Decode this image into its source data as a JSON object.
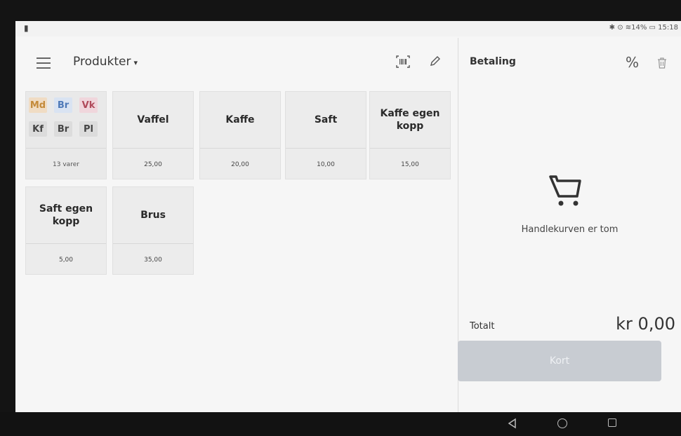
{
  "statusbar": {
    "left_glyph": "▮",
    "right_text": "✱ ⊙ ≋14% ▭ 15:18"
  },
  "header": {
    "title": "Produkter",
    "caret": "▾",
    "icons": [
      "menu-icon",
      "barcode-icon",
      "pencil-icon"
    ]
  },
  "payment": {
    "title": "Betaling",
    "discount": "%",
    "icons": [
      "trash-icon",
      "shopping-cart-icon"
    ],
    "cart_empty": "Handlekurven er tom",
    "total_label": "Totalt",
    "total_value": "kr 0,00",
    "button_label": "Kort"
  },
  "category_tile": {
    "chips": [
      {
        "label": "Md",
        "color": "#c48a3a",
        "bg": "#f0dcc4"
      },
      {
        "label": "Br",
        "color": "#4e79b8",
        "bg": "#d9e3f2"
      },
      {
        "label": "Vk",
        "color": "#b04a5a",
        "bg": "#f0d6dc"
      },
      {
        "label": "Kf",
        "color": "#444444",
        "bg": "#dcdcdc"
      },
      {
        "label": "Br",
        "color": "#444444",
        "bg": "#dcdcdc"
      },
      {
        "label": "Pl",
        "color": "#444444",
        "bg": "#dcdcdc"
      }
    ],
    "count": "13 varer"
  },
  "products": [
    {
      "name": "Vaffel",
      "price": "25,00"
    },
    {
      "name": "Kaffe",
      "price": "20,00"
    },
    {
      "name": "Saft",
      "price": "10,00"
    },
    {
      "name": "Kaffe egen kopp",
      "price": "15,00"
    },
    {
      "name": "Saft egen kopp",
      "price": "5,00"
    },
    {
      "name": "Brus",
      "price": "35,00"
    }
  ],
  "colors": {
    "background": "#f6f6f6",
    "tile": "#ececec",
    "button_disabled": "#c8ccd2"
  }
}
